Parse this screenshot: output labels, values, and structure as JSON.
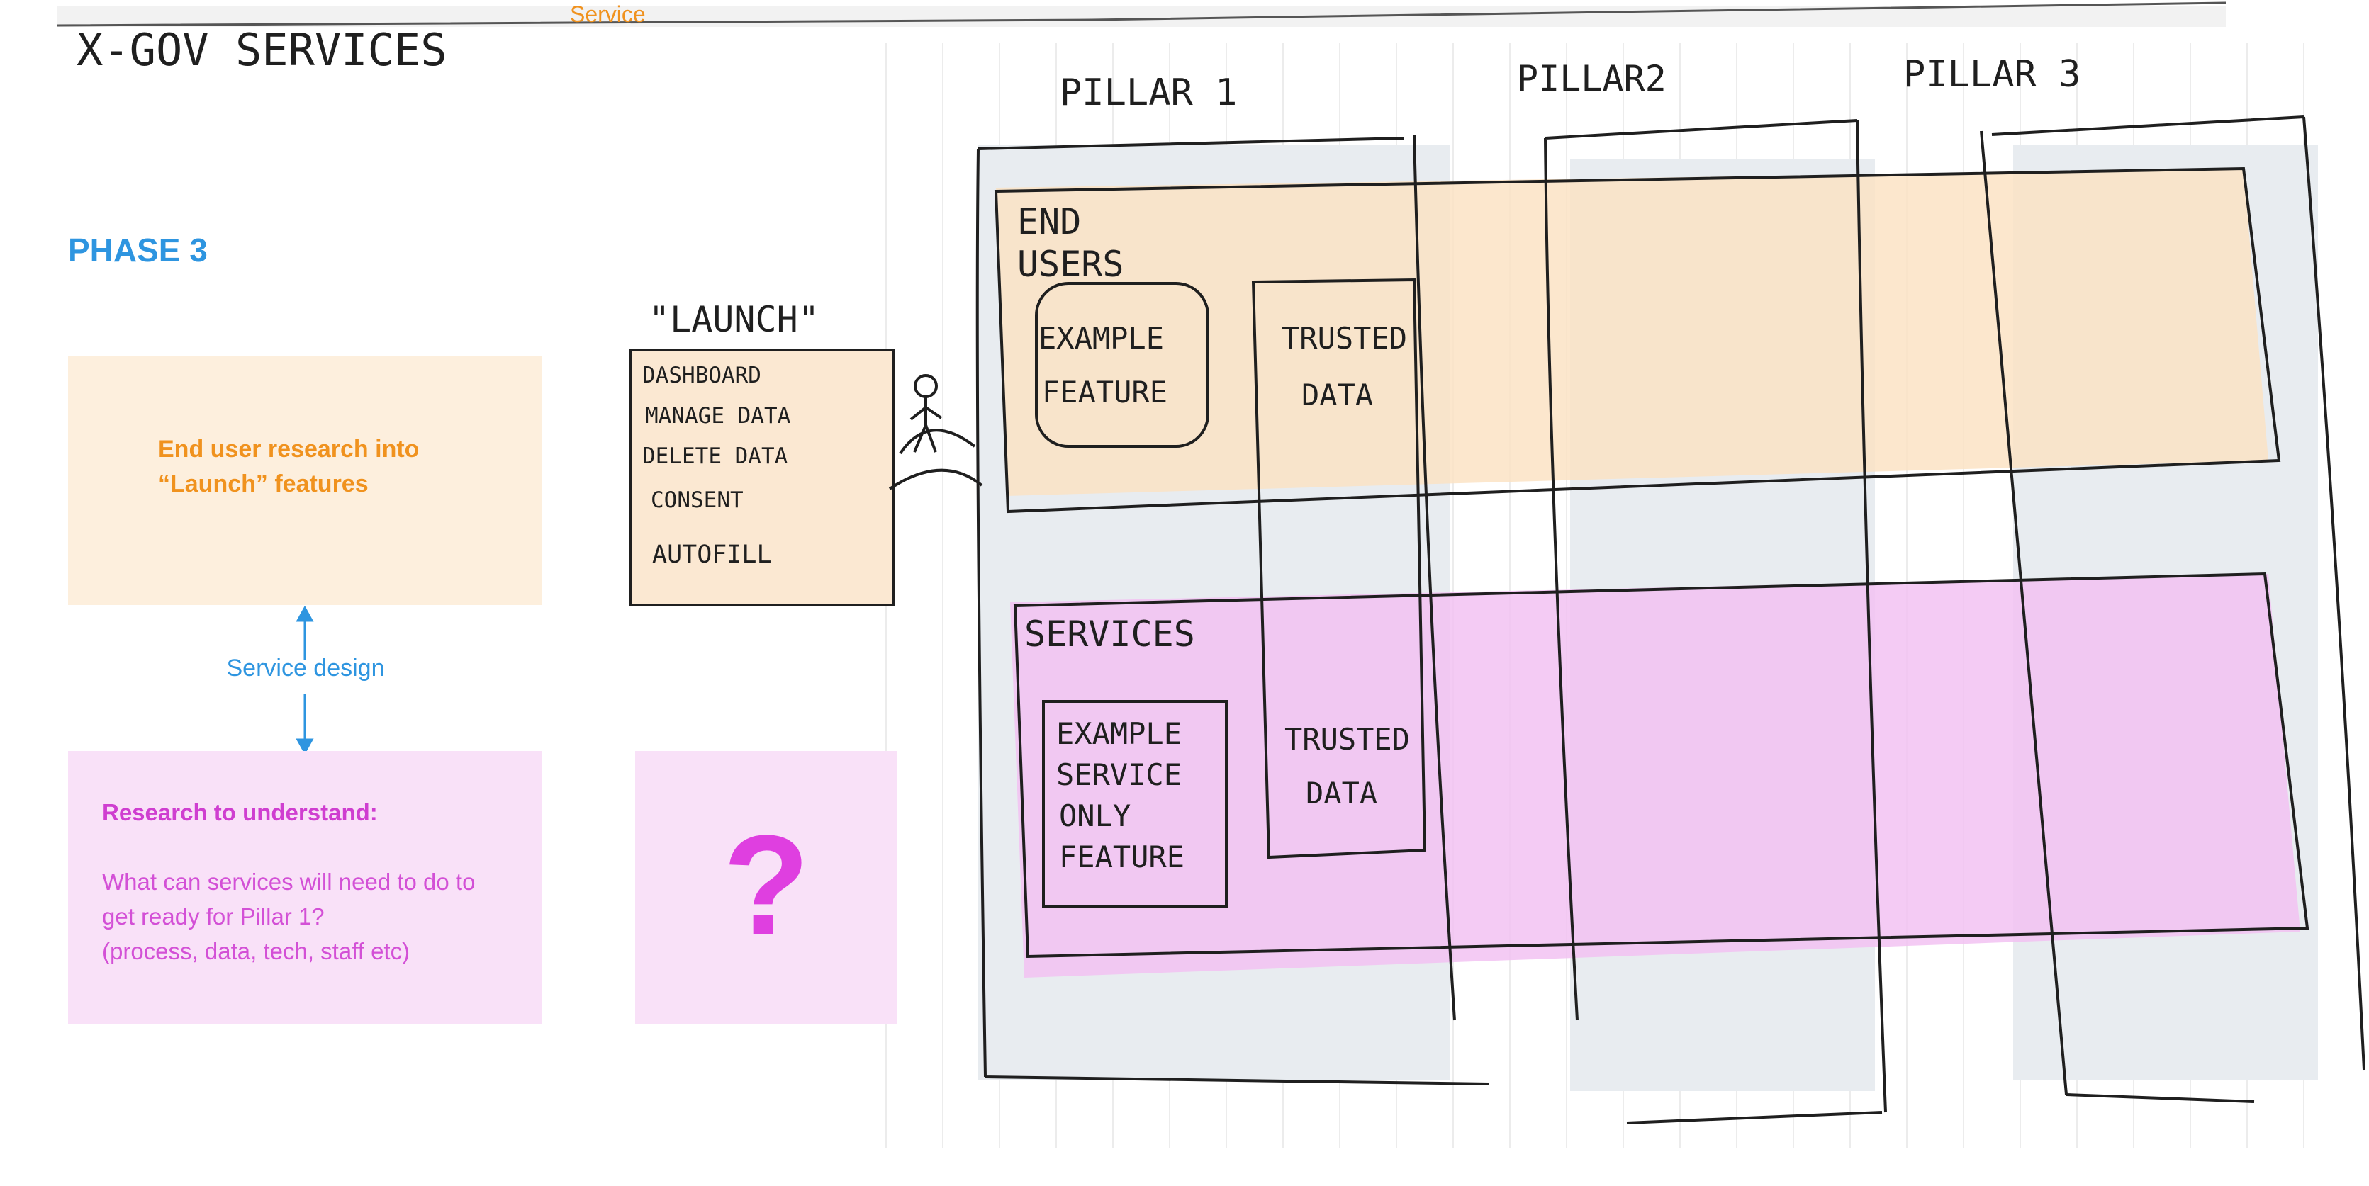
{
  "top_tab": "Service",
  "sketch": {
    "title": "X-GOV SERVICES",
    "pillars": [
      "PILLAR 1",
      "PILLAR2",
      "PILLAR 3"
    ],
    "launch": {
      "title": "\"LAUNCH\"",
      "items": [
        "DASHBOARD",
        "MANAGE DATA",
        "DELETE DATA",
        "CONSENT",
        "AUTOFILL"
      ]
    },
    "end_users": {
      "label": [
        "END",
        "USERS"
      ],
      "example_feature": [
        "EXAMPLE",
        "FEATURE"
      ],
      "trusted_data": [
        "TRUSTED",
        "DATA"
      ]
    },
    "services": {
      "label": "SERVICES",
      "example_service": [
        "EXAMPLE",
        "SERVICE",
        "ONLY",
        "FEATURE"
      ],
      "trusted_data": [
        "TRUSTED",
        "DATA"
      ]
    }
  },
  "phase": {
    "title": "PHASE 3",
    "orange_card_lines": [
      "End user research into",
      "“Launch” features"
    ],
    "connector_label": "Service design",
    "purple_card": {
      "heading": "Research to understand:",
      "lines": [
        "What can services will need to do to",
        "get ready for Pillar 1?",
        "(process, data, tech, staff etc)"
      ]
    },
    "question_mark": "?"
  },
  "colors": {
    "blue": "#2e95e0",
    "orange": "#f0921e",
    "orange_fill": "#fdefdd",
    "purple": "#cf3ed0",
    "purple_fill": "#f9e1f8",
    "pillar_grey": "#e8ecf0"
  }
}
